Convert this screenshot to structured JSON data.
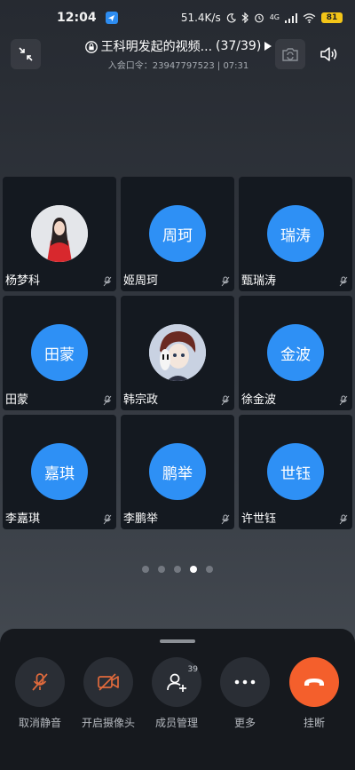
{
  "status_bar": {
    "time": "12:04",
    "network_speed": "51.4K/s",
    "network_type": "4G",
    "battery": "81"
  },
  "meeting": {
    "title": "王科明发起的视频...",
    "participant_count": "(37/39)",
    "subtitle": "入会口令：23947797523 | 07:31"
  },
  "participants": [
    {
      "name": "杨梦科",
      "avatar_text": "",
      "photo": true
    },
    {
      "name": "姬周珂",
      "avatar_text": "周珂",
      "photo": false
    },
    {
      "name": "甄瑞涛",
      "avatar_text": "瑞涛",
      "photo": false
    },
    {
      "name": "田蒙",
      "avatar_text": "田蒙",
      "photo": false
    },
    {
      "name": "韩宗政",
      "avatar_text": "",
      "photo": true
    },
    {
      "name": "徐金波",
      "avatar_text": "金波",
      "photo": false
    },
    {
      "name": "李嘉琪",
      "avatar_text": "嘉琪",
      "photo": false
    },
    {
      "name": "李鹏举",
      "avatar_text": "鹏举",
      "photo": false
    },
    {
      "name": "许世钰",
      "avatar_text": "世钰",
      "photo": false
    }
  ],
  "pager": {
    "page_count": 5,
    "active_page": 4
  },
  "controls": {
    "unmute_label": "取消静音",
    "camera_label": "开启摄像头",
    "members_label": "成员管理",
    "members_count": "39",
    "more_label": "更多",
    "hangup_label": "挂断"
  },
  "colors": {
    "avatar_blue": "#2e90f5",
    "hangup_orange": "#f45f2c",
    "tile_bg": "#141920",
    "panel_bg": "#16191e"
  }
}
